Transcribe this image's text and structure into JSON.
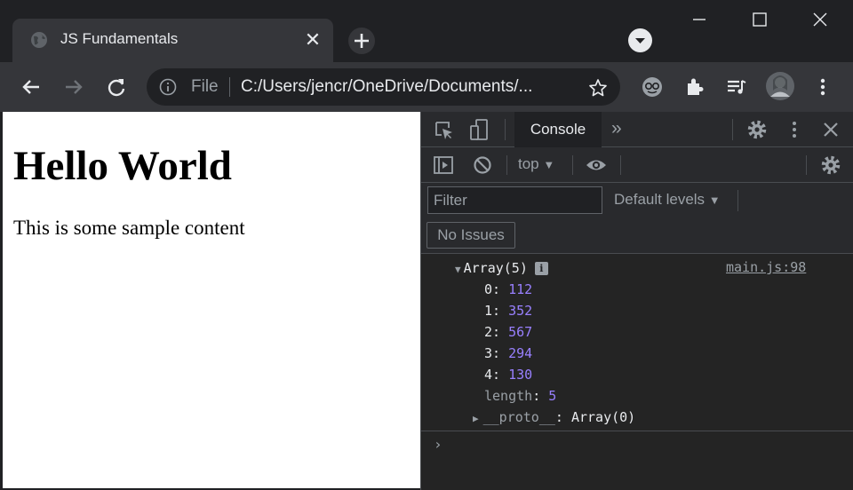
{
  "window": {
    "tab_title": "JS Fundamentals",
    "tab_close_glyph": "✕"
  },
  "toolbar": {
    "scheme_label": "File",
    "url": "C:/Users/jencr/OneDrive/Documents/..."
  },
  "page": {
    "heading": "Hello World",
    "paragraph": "This is some sample content"
  },
  "devtools": {
    "active_tab": "Console",
    "more_tabs_glyph": "»",
    "context": "top",
    "filter_placeholder": "Filter",
    "levels": "Default levels",
    "issues_button": "No Issues",
    "log": {
      "summary": "Array(5)",
      "info_badge": "i",
      "source": "main.js:98",
      "items": [
        {
          "index": "0",
          "value": "112"
        },
        {
          "index": "1",
          "value": "352"
        },
        {
          "index": "2",
          "value": "567"
        },
        {
          "index": "3",
          "value": "294"
        },
        {
          "index": "4",
          "value": "130"
        }
      ],
      "length_key": "length",
      "length_value": "5",
      "proto_key": "__proto__",
      "proto_value": "Array(0)"
    },
    "prompt_glyph": "›"
  },
  "colors": {
    "chrome_dark": "#202124",
    "chrome_toolbar": "#35363a",
    "devtools_bg": "#242424",
    "devtools_panel": "#292a2d",
    "text_light": "#e8eaed",
    "text_dim": "#9aa0a6"
  }
}
